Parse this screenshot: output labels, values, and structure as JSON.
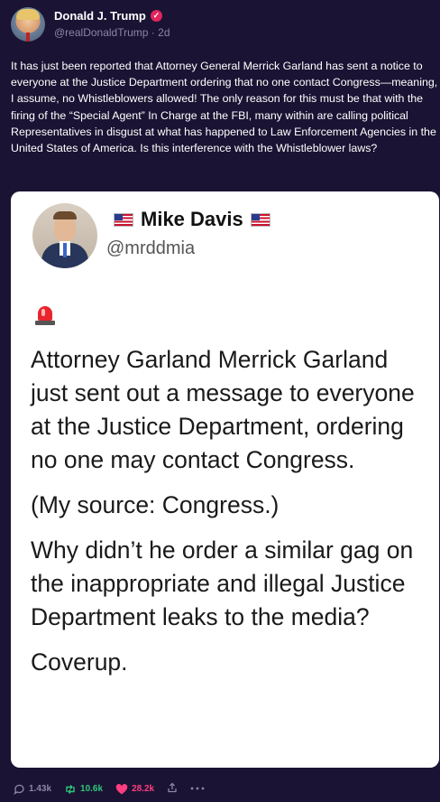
{
  "post": {
    "author_name": "Donald J. Trump",
    "handle": "@realDonaldTrump",
    "separator": "·",
    "time": "2d",
    "body": "It has just been reported that Attorney General Merrick Garland has sent a notice to everyone at the Justice Department ordering that no one contact Congress—meaning, I assume, no Whistleblowers allowed! The only reason for this must be that with the firing of the “Special Agent” In Charge at the FBI, many within are calling political Representatives in disgust at what has happened to Law Enforcement Agencies in the United States of America. Is this interference with the Whistleblower laws?"
  },
  "quoted": {
    "name": "Mike Davis",
    "handle": "@mrddmia",
    "paragraphs": [
      "Attorney Garland Merrick Garland just sent out a message to everyone at the Justice Department, ordering no one may contact Congress.",
      "(My source: Congress.)",
      "Why didn’t he order a similar gag on the inappropriate and illegal Justice Department leaks to the media?",
      "Coverup."
    ]
  },
  "stats": {
    "replies": "1.43k",
    "retweets": "10.6k",
    "likes": "28.2k"
  },
  "icons": {
    "verified": "verified-badge-icon",
    "flag": "us-flag-icon",
    "siren": "siren-icon",
    "reply": "reply-icon",
    "retweet": "retweet-icon",
    "like": "heart-icon",
    "share": "share-icon",
    "more": "more-icon"
  },
  "colors": {
    "background": "#1a1333",
    "verified": "#e0245e",
    "retweet": "#2fc77a",
    "like": "#ff3d7f",
    "muted": "#8b86a3"
  }
}
